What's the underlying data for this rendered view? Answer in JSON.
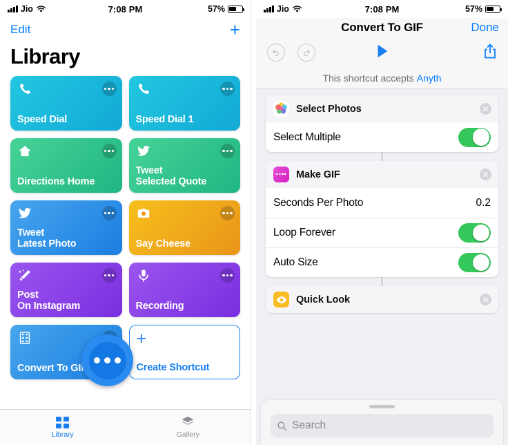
{
  "status_bar": {
    "carrier": "Jio",
    "time": "7:08 PM",
    "battery_percent": "57%",
    "signal_icon": "cellular-bars-icon",
    "wifi_icon": "wifi-icon",
    "battery_icon": "battery-icon"
  },
  "left_screen": {
    "nav": {
      "edit_label": "Edit",
      "add_label": "+"
    },
    "title": "Library",
    "shortcuts": [
      {
        "name": "Speed Dial",
        "icon": "phone-icon",
        "color_start": "#22c7e0",
        "color_end": "#13a9d6"
      },
      {
        "name": "Speed Dial 1",
        "icon": "phone-icon",
        "color_start": "#22c7e0",
        "color_end": "#13a9d6"
      },
      {
        "name": "Directions Home",
        "icon": "home-icon",
        "color_start": "#3ecf8e",
        "color_end": "#22b887"
      },
      {
        "name": "Tweet\nSelected Quote",
        "icon": "twitter-icon",
        "color_start": "#3ecf8e",
        "color_end": "#1fb583"
      },
      {
        "name": "Tweet\nLatest Photo",
        "icon": "twitter-icon",
        "color_start": "#3f9fe8",
        "color_end": "#1b7ee0"
      },
      {
        "name": "Say Cheese",
        "icon": "camera-icon",
        "color_start": "#f5b91b",
        "color_end": "#e8951a"
      },
      {
        "name": "Post\nOn Instagram",
        "icon": "magic-wand-icon",
        "color_start": "#8e45e8",
        "color_end": "#7a2ee0"
      },
      {
        "name": "Recording",
        "icon": "microphone-icon",
        "color_start": "#8e45e8",
        "color_end": "#7a2ee0"
      },
      {
        "name": "Convert To GIF",
        "icon": "film-icon",
        "color_start": "#3f9fe8",
        "color_end": "#1b7ee0"
      }
    ],
    "create_shortcut": {
      "label": "Create Shortcut",
      "icon": "plus-icon",
      "accent": "#1a7ef0"
    },
    "more_callout": {
      "icon": "ellipsis-icon",
      "dots": "•••",
      "accent": "#1478e4"
    },
    "tabs": [
      {
        "label": "Library",
        "icon": "grid-icon",
        "active": true
      },
      {
        "label": "Gallery",
        "icon": "layers-icon",
        "active": false
      }
    ]
  },
  "right_screen": {
    "nav": {
      "title": "Convert To GIF",
      "done_label": "Done"
    },
    "toolbar": {
      "undo_icon": "undo-icon",
      "redo_icon": "redo-icon",
      "play_icon": "play-icon",
      "share_icon": "share-icon",
      "settings_icon": "settings-toggles-icon"
    },
    "accepts_prefix": "This shortcut accepts",
    "accepts_type": "Anyth",
    "share_callout": {
      "icon": "share-icon",
      "accent": "#007aff"
    },
    "actions": [
      {
        "title": "Select Photos",
        "app_icon": "photos-app-icon",
        "remove_icon": "close-circle-icon",
        "rows": [
          {
            "label": "Select Multiple",
            "type": "toggle",
            "value": "on"
          }
        ]
      },
      {
        "title": "Make GIF",
        "app_icon": "make-gif-icon",
        "remove_icon": "close-circle-icon",
        "rows": [
          {
            "label": "Seconds Per Photo",
            "type": "value",
            "value": "0.2"
          },
          {
            "label": "Loop Forever",
            "type": "toggle",
            "value": "on"
          },
          {
            "label": "Auto Size",
            "type": "toggle",
            "value": "on"
          }
        ]
      },
      {
        "title": "Quick Look",
        "app_icon": "quick-look-icon",
        "remove_icon": "close-circle-icon",
        "rows": []
      }
    ],
    "sheet": {
      "handle_icon": "grabber-icon",
      "search_placeholder": "Search",
      "search_icon": "search-icon",
      "search_value": ""
    }
  }
}
